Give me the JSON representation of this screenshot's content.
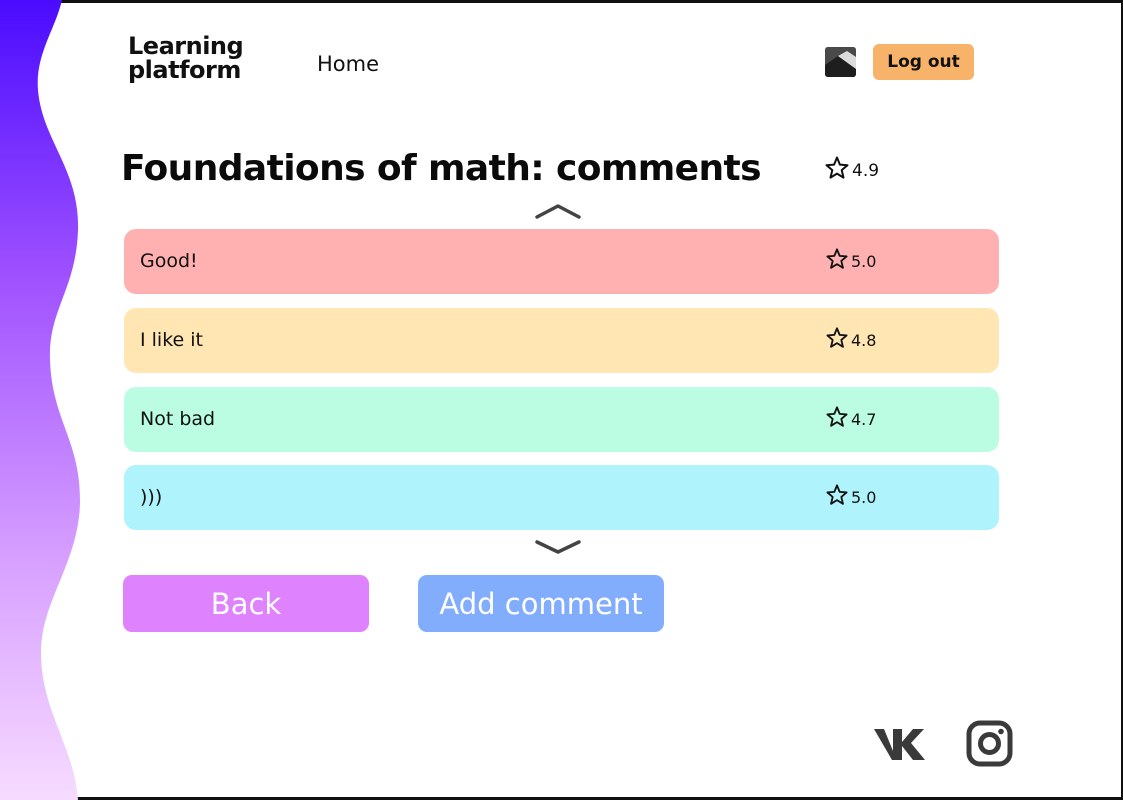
{
  "header": {
    "logo_line1": "Learning",
    "logo_line2": "platform",
    "nav_home": "Home",
    "logout_label": "Log out",
    "avatar_icon": "image-icon"
  },
  "page": {
    "title": "Foundations of math: comments",
    "course_rating": "4.9"
  },
  "comments": [
    {
      "text": "Good!",
      "rating": "5.0",
      "color": "#ffb1b1"
    },
    {
      "text": "I like it",
      "rating": "4.8",
      "color": "#ffe6b3"
    },
    {
      "text": "Not bad",
      "rating": "4.7",
      "color": "#bbfde3"
    },
    {
      "text": ")))",
      "rating": "5.0",
      "color": "#aff4fd"
    }
  ],
  "actions": {
    "back_label": "Back",
    "add_comment_label": "Add comment",
    "back_color": "#df82fd",
    "add_color": "#82adfd"
  },
  "footer": {
    "social_icons": [
      "vk-icon",
      "instagram-icon"
    ]
  },
  "theme": {
    "accent_top": "#4a0bff",
    "accent_bottom": "#f5d5ff"
  }
}
